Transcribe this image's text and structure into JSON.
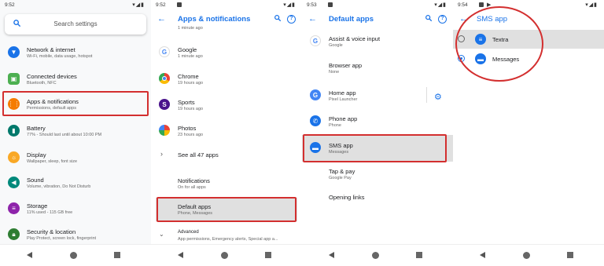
{
  "panels": [
    {
      "time": "9:52",
      "search_placeholder": "Search settings",
      "items": [
        {
          "title": "Network & internet",
          "sub": "Wi-Fi, mobile, data usage, hotspot",
          "color": "#1a73e8"
        },
        {
          "title": "Connected devices",
          "sub": "Bluetooth, NFC",
          "color": "#4caf50"
        },
        {
          "title": "Apps & notifications",
          "sub": "Permissions, default apps",
          "color": "#f57c00"
        },
        {
          "title": "Battery",
          "sub": "77% - Should last until about 10:00 PM",
          "color": "#00796b"
        },
        {
          "title": "Display",
          "sub": "Wallpaper, sleep, font size",
          "color": "#f9a825"
        },
        {
          "title": "Sound",
          "sub": "Volume, vibration, Do Not Disturb",
          "color": "#00897b"
        },
        {
          "title": "Storage",
          "sub": "11% used - 115 GB free",
          "color": "#8e24aa"
        },
        {
          "title": "Security & location",
          "sub": "Play Protect, screen lock, fingerprint",
          "color": "#2e7d32"
        }
      ]
    },
    {
      "time": "9:52",
      "title": "Apps & notifications",
      "top_partial": "1 minute ago",
      "items": [
        {
          "title": "Google",
          "sub": "1 minute ago"
        },
        {
          "title": "Chrome",
          "sub": "19 hours ago"
        },
        {
          "title": "Sports",
          "sub": "19 hours ago"
        },
        {
          "title": "Photos",
          "sub": "23 hours ago"
        }
      ],
      "see_all": "See all 47 apps",
      "notifications": {
        "title": "Notifications",
        "sub": "On for all apps"
      },
      "default_apps": {
        "title": "Default apps",
        "sub": "Phone, Messages"
      },
      "advanced": {
        "title": "Advanced",
        "sub": "App permissions, Emergency alerts, Special app a..."
      }
    },
    {
      "time": "9:53",
      "title": "Default apps",
      "items": [
        {
          "title": "Assist & voice input",
          "sub": "Google"
        },
        {
          "title": "Browser app",
          "sub": "None"
        },
        {
          "title": "Home app",
          "sub": "Pixel Launcher"
        },
        {
          "title": "Phone app",
          "sub": "Phone"
        },
        {
          "title": "SMS app",
          "sub": "Messages"
        },
        {
          "title": "Tap & pay",
          "sub": "Google Pay"
        },
        {
          "title": "Opening links",
          "sub": ""
        }
      ]
    },
    {
      "time": "9:54",
      "title": "SMS app",
      "options": [
        {
          "label": "Textra",
          "selected": false
        },
        {
          "label": "Messages",
          "selected": true
        }
      ]
    }
  ],
  "status_icons": "▾◢▮",
  "accent": "#1a73e8",
  "highlight_color": "#d32f2f"
}
